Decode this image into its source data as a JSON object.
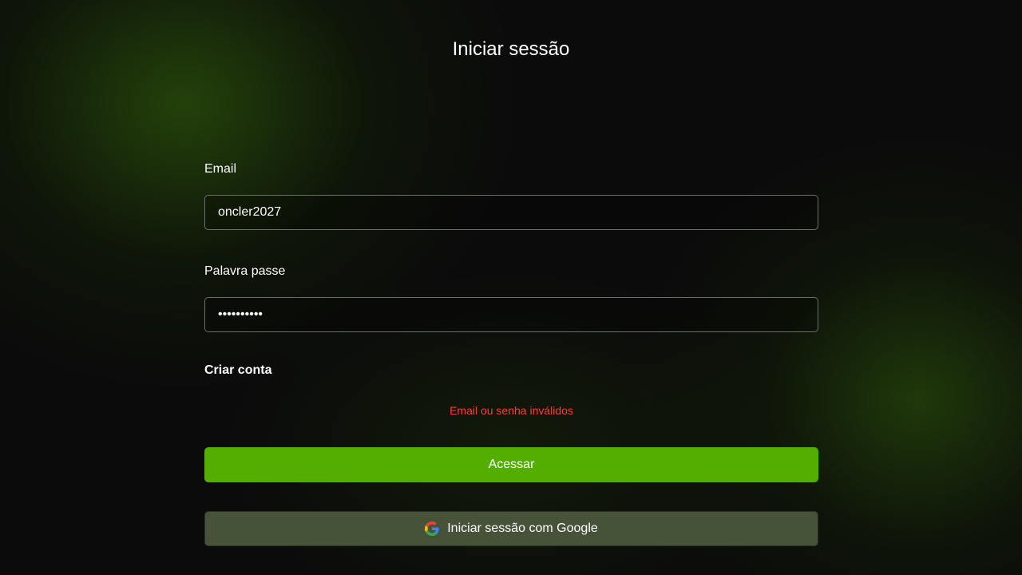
{
  "page": {
    "title": "Iniciar sessão"
  },
  "form": {
    "email_label": "Email",
    "email_value": "oncler2027",
    "password_label": "Palavra passe",
    "password_value": "••••••••••",
    "create_account_label": "Criar conta",
    "error_message": "Email ou senha inválidos",
    "submit_label": "Acessar",
    "google_label": "Iniciar sessão com Google",
    "google_icon": "google-g-icon"
  },
  "colors": {
    "primary_button": "#52ae00",
    "error_text": "#ff3b3b",
    "google_button": "#465339"
  }
}
